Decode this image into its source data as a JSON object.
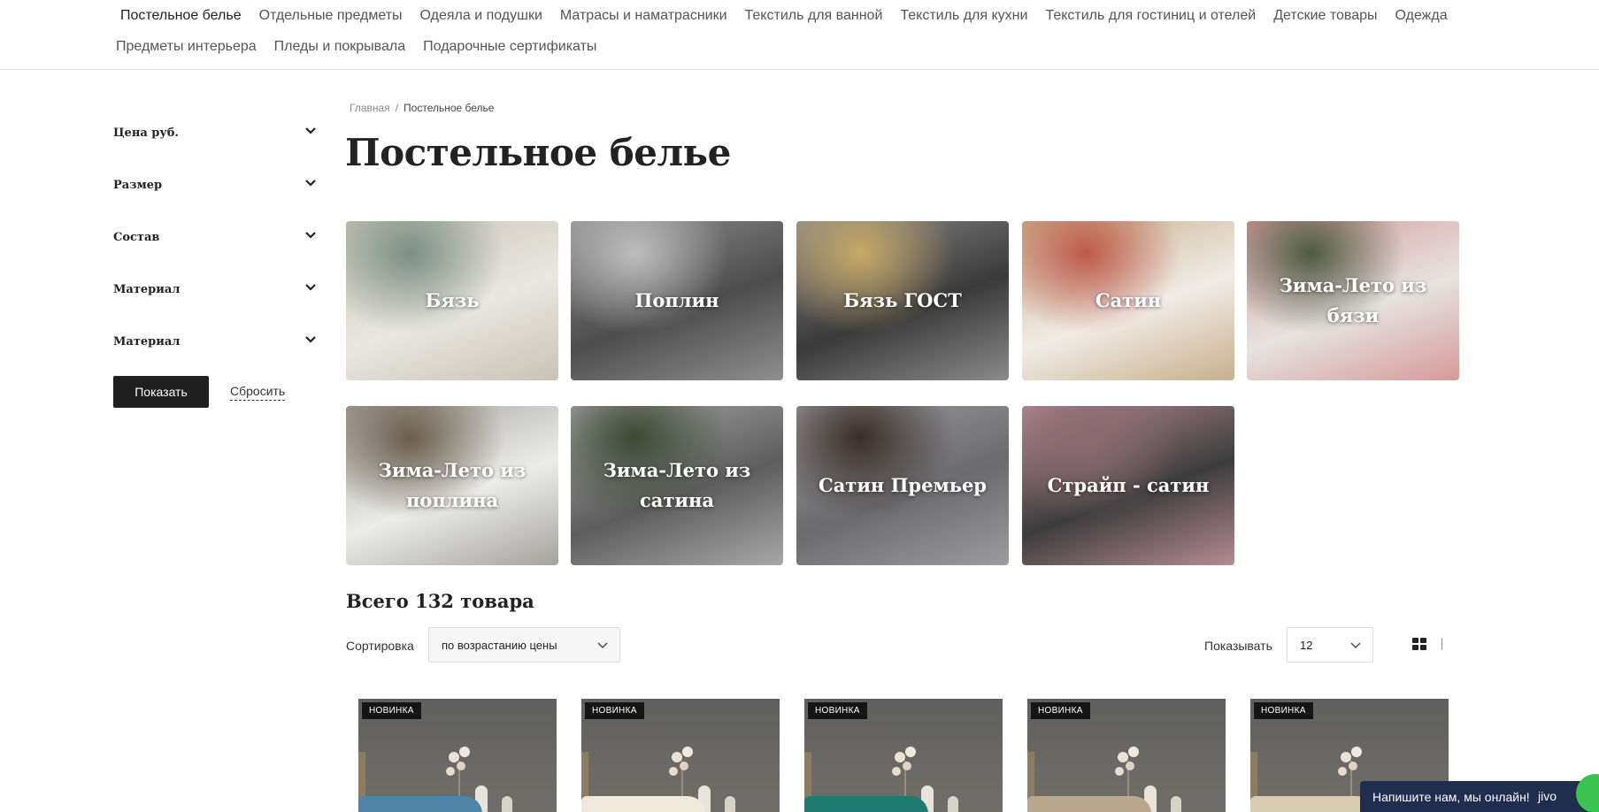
{
  "topnav": {
    "row1": [
      {
        "label": "Постельное белье",
        "active": true
      },
      {
        "label": "Отдельные предметы"
      },
      {
        "label": "Одеяла и подушки"
      },
      {
        "label": "Матрасы и наматрасники"
      },
      {
        "label": "Текстиль для ванной"
      },
      {
        "label": "Текстиль для кухни"
      },
      {
        "label": "Текстиль для гостиниц и отелей"
      },
      {
        "label": "Детские товары"
      },
      {
        "label": "Одежда"
      }
    ],
    "row2": [
      {
        "label": "Предметы интерьера"
      },
      {
        "label": "Пледы и покрывала"
      },
      {
        "label": "Подарочные сертификаты"
      }
    ]
  },
  "sidebar": {
    "filters": [
      {
        "label": "Цена руб."
      },
      {
        "label": "Размер"
      },
      {
        "label": "Состав"
      },
      {
        "label": "Материал"
      },
      {
        "label": "Материал"
      }
    ],
    "show_label": "Показать",
    "reset_label": "Сбросить"
  },
  "breadcrumb": {
    "home": "Главная",
    "separator": "/",
    "current": "Постельное белье"
  },
  "page_title": "Постельное белье",
  "categories": [
    {
      "label": "Бязь",
      "palette": [
        "#e9e7e1",
        "#c9c3b5",
        "#7b8f86"
      ]
    },
    {
      "label": "Поплин",
      "palette": [
        "#4d4d4d",
        "#8f8f8f",
        "#bdbdbd"
      ]
    },
    {
      "label": "Бязь ГОСТ",
      "palette": [
        "#3a3a3a",
        "#8a8a8a",
        "#c7a967"
      ]
    },
    {
      "label": "Сатин",
      "palette": [
        "#f0ece6",
        "#c7b08c",
        "#bf5a4a"
      ]
    },
    {
      "label": "Зима-Лето из бязи",
      "palette": [
        "#e6e3e0",
        "#d59a9a",
        "#4e5a44"
      ]
    },
    {
      "label": "Зима-Лето из поплина",
      "palette": [
        "#ececea",
        "#a4a39e",
        "#6a5e4d"
      ]
    },
    {
      "label": "Зима-Лето из сатина",
      "palette": [
        "#5d5d5d",
        "#a8a8a8",
        "#3c4a34"
      ]
    },
    {
      "label": "Сатин Премьер",
      "palette": [
        "#6b6b6e",
        "#9c9ca0",
        "#3a2e28"
      ]
    },
    {
      "label": "Страйп - сатин",
      "palette": [
        "#3d3d3d",
        "#b58b93",
        "#8b6a70"
      ]
    }
  ],
  "catalog": {
    "total": "Всего 132 товара",
    "sort_label": "Сортировка",
    "sort_value": "по возрастанию цены",
    "show_label": "Показывать",
    "show_value": "12"
  },
  "products": [
    {
      "badge": "НОВИНКА",
      "bed_color": "#4f84a8"
    },
    {
      "badge": "НОВИНКА",
      "bed_color": "#efe9dc"
    },
    {
      "badge": "НОВИНКА",
      "bed_color": "#1f7b70"
    },
    {
      "badge": "НОВИНКА",
      "bed_color": "#b7a88e"
    },
    {
      "badge": "НОВИНКА",
      "bed_color": "#d9cbb0"
    }
  ],
  "chat": {
    "text": "Напишите нам, мы онлайн!",
    "brand": "jivo"
  }
}
